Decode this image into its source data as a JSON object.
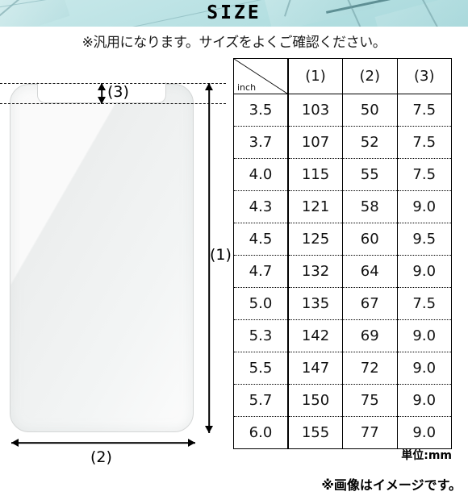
{
  "header": {
    "title": "SIZE",
    "background_color": "#b8e2e4"
  },
  "subtitle": "※汎用になります。サイズをよくご確認ください。",
  "diagram": {
    "name": "tempered-glass-screen-protector",
    "labels": {
      "height": "(1)",
      "width": "(2)",
      "notch": "(3)"
    }
  },
  "table": {
    "corner_label": "inch",
    "columns": [
      "(1)",
      "(2)",
      "(3)"
    ],
    "rows": [
      {
        "inch": "3.5",
        "c1": "103",
        "c2": "50",
        "c3": "7.5"
      },
      {
        "inch": "3.7",
        "c1": "107",
        "c2": "52",
        "c3": "7.5"
      },
      {
        "inch": "4.0",
        "c1": "115",
        "c2": "55",
        "c3": "7.5"
      },
      {
        "inch": "4.3",
        "c1": "121",
        "c2": "58",
        "c3": "9.0"
      },
      {
        "inch": "4.5",
        "c1": "125",
        "c2": "60",
        "c3": "9.5"
      },
      {
        "inch": "4.7",
        "c1": "132",
        "c2": "64",
        "c3": "9.0"
      },
      {
        "inch": "5.0",
        "c1": "135",
        "c2": "67",
        "c3": "7.5"
      },
      {
        "inch": "5.3",
        "c1": "142",
        "c2": "69",
        "c3": "9.0"
      },
      {
        "inch": "5.5",
        "c1": "147",
        "c2": "72",
        "c3": "9.0"
      },
      {
        "inch": "5.7",
        "c1": "150",
        "c2": "75",
        "c3": "9.0"
      },
      {
        "inch": "6.0",
        "c1": "155",
        "c2": "77",
        "c3": "9.0"
      }
    ],
    "unit_note": "単位:mm"
  },
  "footer": {
    "note": "※画像はイメージです。"
  },
  "chart_data": {
    "type": "table",
    "title": "SIZE",
    "columns": [
      "inch",
      "(1)",
      "(2)",
      "(3)"
    ],
    "unit": "mm",
    "values": [
      [
        "3.5",
        103,
        50,
        7.5
      ],
      [
        "3.7",
        107,
        52,
        7.5
      ],
      [
        "4.0",
        115,
        55,
        7.5
      ],
      [
        "4.3",
        121,
        58,
        9.0
      ],
      [
        "4.5",
        125,
        60,
        9.5
      ],
      [
        "4.7",
        132,
        64,
        9.0
      ],
      [
        "5.0",
        135,
        67,
        7.5
      ],
      [
        "5.3",
        142,
        69,
        9.0
      ],
      [
        "5.5",
        147,
        72,
        9.0
      ],
      [
        "5.7",
        150,
        75,
        9.0
      ],
      [
        "6.0",
        155,
        77,
        9.0
      ]
    ]
  }
}
